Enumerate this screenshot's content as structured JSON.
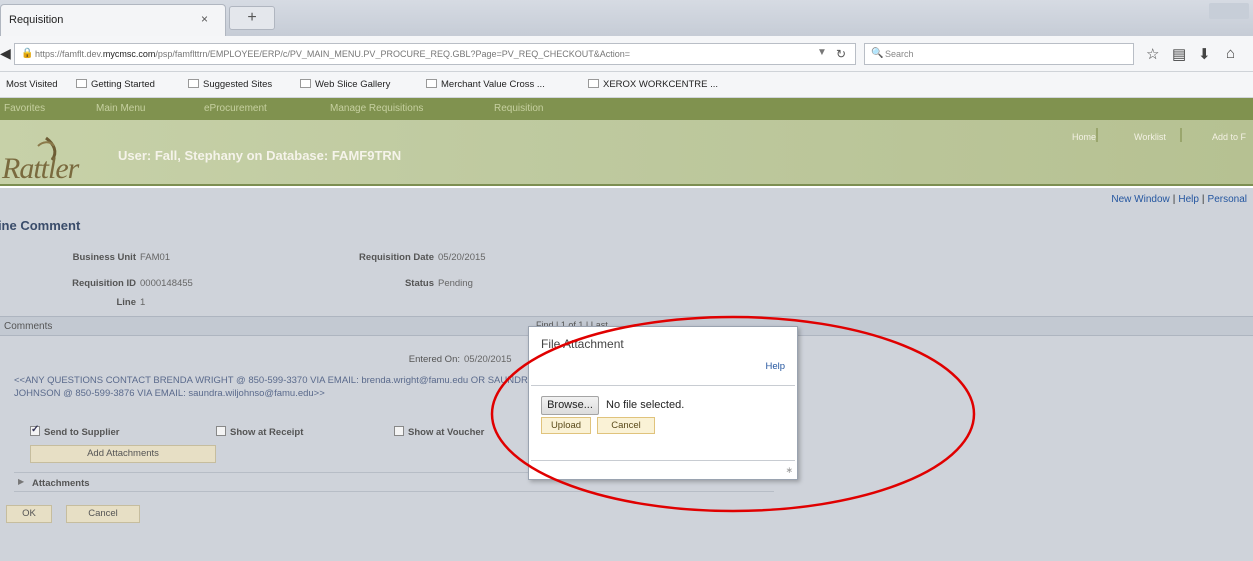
{
  "browser": {
    "tab_title": "Requisition",
    "tab_close": "×",
    "new_tab": "+",
    "url_prefix": "https://famflt.dev.",
    "url_domain": "mycmsc.com",
    "url_rest": "/psp/famflttrn/EMPLOYEE/ERP/c/PV_MAIN_MENU.PV_PROCURE_REQ.GBL?Page=PV_REQ_CHECKOUT&Action=",
    "search_placeholder": "Search",
    "bookmarks": [
      "Most Visited",
      "Getting Started",
      "Suggested Sites",
      "Web Slice Gallery",
      "Merchant Value Cross ...",
      "XEROX WORKCENTRE ..."
    ]
  },
  "app": {
    "menu": [
      "Favorites",
      "Main Menu",
      "eProcurement",
      "Manage Requisitions",
      "Requisition"
    ],
    "logo_text": "Rattler",
    "user_line": "User: Fall, Stephany on Database: FAMF9TRN",
    "header_links": [
      "Home",
      "Worklist",
      "Add to F"
    ],
    "top_links": [
      "New Window",
      "Help",
      "Personal"
    ]
  },
  "page": {
    "title": "Line Comment",
    "fields": {
      "business_unit_label": "Business Unit",
      "business_unit": "FAM01",
      "req_id_label": "Requisition ID",
      "req_id": "0000148455",
      "line_label": "Line",
      "line": "1",
      "req_date_label": "Requisition Date",
      "req_date": "05/20/2015",
      "status_label": "Status",
      "status": "Pending"
    },
    "comments_section": "Comments",
    "find_text": "Find | 1 of 1 | Last",
    "entered_on_label": "Entered On:",
    "entered_on": "05/20/2015",
    "comment_line1": "<<ANY QUESTIONS CONTACT BRENDA WRIGHT @ 850-599-3370 VIA EMAIL: brenda.wright@famu.edu OR SAUNDRA",
    "comment_line2": "JOHNSON @ 850-599-3876 VIA EMAIL: saundra.wiljohnso@famu.edu>>",
    "send_to_supplier": "Send to Supplier",
    "show_at_receipt": "Show at Receipt",
    "show_at_voucher": "Show at Voucher",
    "add_attachments": "Add Attachments",
    "attachments": "Attachments",
    "ok": "OK",
    "cancel": "Cancel"
  },
  "modal": {
    "title": "File Attachment",
    "help": "Help",
    "browse": "Browse...",
    "no_file": "No file selected.",
    "upload": "Upload",
    "cancel": "Cancel"
  },
  "colors": {
    "banner_green": "#80924f",
    "annotation_red": "#e00000",
    "link_blue": "#2456a0"
  }
}
